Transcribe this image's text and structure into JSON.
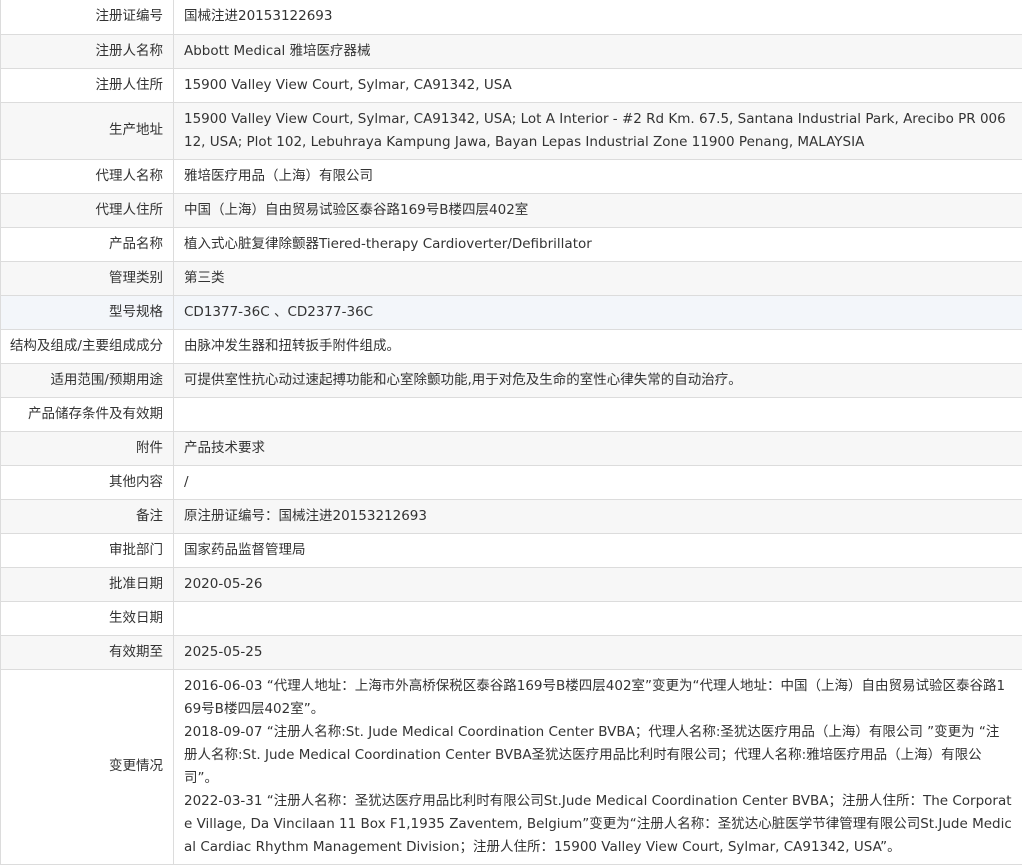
{
  "rows": [
    {
      "label": "注册证编号",
      "value": "国械注进20153122693"
    },
    {
      "label": "注册人名称",
      "value": "Abbott Medical 雅培医疗器械"
    },
    {
      "label": "注册人住所",
      "value": "15900 Valley View Court, Sylmar, CA91342, USA"
    },
    {
      "label": "生产地址",
      "value": "15900 Valley View Court, Sylmar, CA91342, USA; Lot A Interior - #2 Rd Km. 67.5, Santana Industrial Park, Arecibo PR 00612, USA; Plot 102, Lebuhraya Kampung Jawa, Bayan Lepas Industrial Zone 11900 Penang, MALAYSIA"
    },
    {
      "label": "代理人名称",
      "value": "雅培医疗用品（上海）有限公司"
    },
    {
      "label": "代理人住所",
      "value": "中国（上海）自由贸易试验区泰谷路169号B楼四层402室"
    },
    {
      "label": "产品名称",
      "value": "植入式心脏复律除颤器Tiered-therapy Cardioverter/Defibrillator"
    },
    {
      "label": "管理类别",
      "value": "第三类"
    },
    {
      "label": "型号规格",
      "value": "CD1377-36C 、CD2377-36C"
    },
    {
      "label": "结构及组成/主要组成成分",
      "value": "由脉冲发生器和扭转扳手附件组成。"
    },
    {
      "label": "适用范围/预期用途",
      "value": "可提供室性抗心动过速起搏功能和心室除颤功能,用于对危及生命的室性心律失常的自动治疗。"
    },
    {
      "label": "产品储存条件及有效期",
      "value": ""
    },
    {
      "label": "附件",
      "value": "产品技术要求"
    },
    {
      "label": "其他内容",
      "value": "/"
    },
    {
      "label": "备注",
      "value": "原注册证编号：国械注进20153212693"
    },
    {
      "label": "审批部门",
      "value": "国家药品监督管理局"
    },
    {
      "label": "批准日期",
      "value": "2020-05-26"
    },
    {
      "label": "生效日期",
      "value": ""
    },
    {
      "label": "有效期至",
      "value": "2025-05-25"
    }
  ],
  "changes": {
    "label": "变更情况",
    "entries": [
      "2016-06-03 “代理人地址：上海市外高桥保税区泰谷路169号B楼四层402室”变更为“代理人地址：中国（上海）自由贸易试验区泰谷路169号B楼四层402室”。",
      "2018-09-07 “注册人名称:St. Jude Medical Coordination Center BVBA；代理人名称:圣犹达医疗用品（上海）有限公司 ”变更为 “注册人名称:St. Jude Medical Coordination Center BVBA圣犹达医疗用品比利时有限公司；代理人名称:雅培医疗用品（上海）有限公司”。",
      "2022-03-31 “注册人名称：圣犹达医疗用品比利时有限公司St.Jude Medical Coordination Center BVBA；注册人住所：The Corporate Village, Da Vincilaan 11 Box F1,1935 Zaventem, Belgium”变更为“注册人名称：圣犹达心脏医学节律管理有限公司St.Jude Medical Cardiac Rhythm Management Division；注册人住所：15900 Valley View Court, Sylmar, CA91342, USA”。"
    ]
  }
}
